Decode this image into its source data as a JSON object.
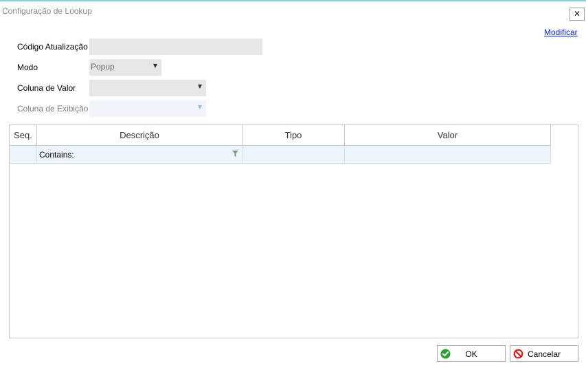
{
  "window": {
    "title": "Configuração de Lookup",
    "close_glyph": "✕"
  },
  "header": {
    "modify_link": "Modificar"
  },
  "form": {
    "codigo_label": "Código Atualização",
    "codigo_value": "",
    "modo_label": "Modo",
    "modo_value": "Popup",
    "coluna_valor_label": "Coluna de Valor",
    "coluna_valor_value": "",
    "coluna_exibicao_label": "Coluna de Exibição",
    "coluna_exibicao_value": "",
    "dropdown_arrow": "▼"
  },
  "grid": {
    "columns": [
      "Seq.",
      "Descrição",
      "Tipo",
      "Valor"
    ],
    "filter_text": "Contains:",
    "rows": []
  },
  "footer": {
    "ok_label": "OK",
    "cancel_label": "Cancelar"
  },
  "colors": {
    "accent_top": "#7fd3e3",
    "ok_icon": "#2e9e2e",
    "cancel_icon": "#e01818",
    "link": "#0a1ef0"
  }
}
